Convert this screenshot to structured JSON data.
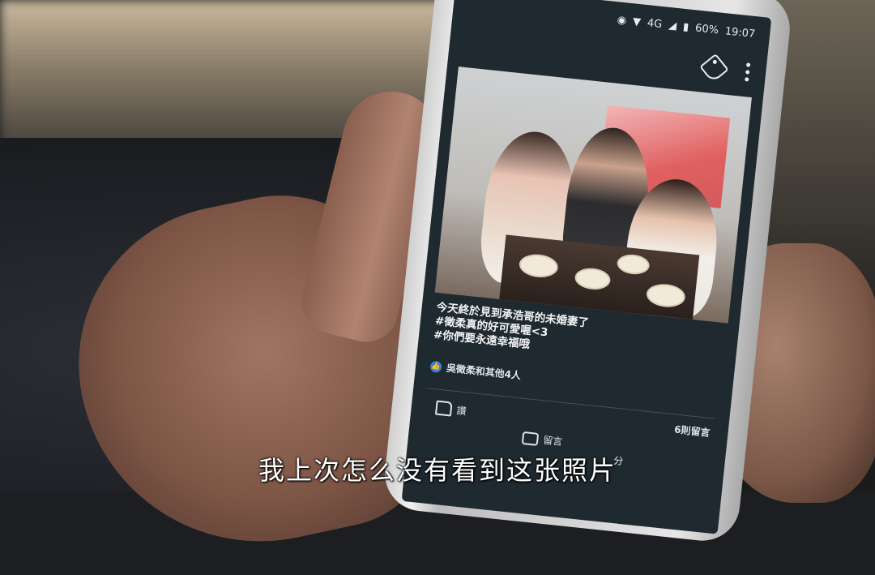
{
  "status_bar": {
    "network": "4G",
    "battery": "60%",
    "time": "19:07"
  },
  "toolbar": {
    "tag_icon": "tag-icon",
    "more_icon": "more-vertical-icon"
  },
  "post": {
    "caption_lines": [
      "今天終於見到承浩哥的未婚妻了",
      "#徵柔真的好可愛喔<3",
      "#你們要永遠幸福哦"
    ],
    "likes_text": "吳徵柔和其他4人",
    "like_label": "讚",
    "comment_label": "留言",
    "share_label": "分",
    "comment_count": "6則留言"
  },
  "subtitle": "我上次怎么没有看到这张照片"
}
